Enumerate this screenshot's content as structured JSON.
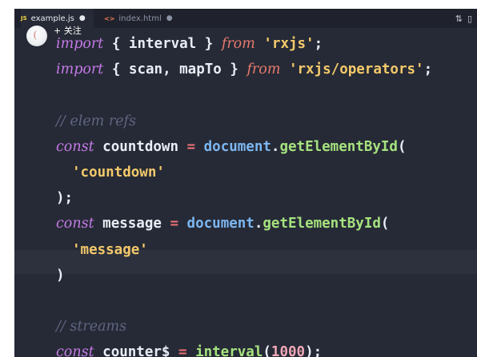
{
  "tabs": [
    {
      "icon": "JS",
      "name": "example.js",
      "modified": "●",
      "active": true
    },
    {
      "icon": "<>",
      "name": "index.html",
      "modified": "●",
      "active": false
    }
  ],
  "tab_actions": [
    "⇅",
    "▯"
  ],
  "overlay": {
    "follow_label": "+ 关注"
  },
  "code_lines": [
    {
      "tokens": [
        [
          "kw",
          "import"
        ],
        [
          "plain",
          " { interval } "
        ],
        [
          "from",
          "from"
        ],
        [
          "plain",
          " "
        ],
        [
          "str",
          "'rxjs'"
        ],
        [
          "plain",
          ";"
        ]
      ]
    },
    {
      "tokens": [
        [
          "kw",
          "import"
        ],
        [
          "plain",
          " { scan, mapTo } "
        ],
        [
          "from",
          "from"
        ],
        [
          "plain",
          " "
        ],
        [
          "str",
          "'rxjs/operators'"
        ],
        [
          "plain",
          ";"
        ]
      ]
    },
    {
      "tokens": []
    },
    {
      "tokens": [
        [
          "cmt",
          "// elem refs"
        ]
      ]
    },
    {
      "tokens": [
        [
          "kw",
          "const"
        ],
        [
          "plain",
          " countdown "
        ],
        [
          "op",
          "="
        ],
        [
          "plain",
          " "
        ],
        [
          "obj",
          "document"
        ],
        [
          "plain",
          "."
        ],
        [
          "fn",
          "getElementById"
        ],
        [
          "plain",
          "("
        ]
      ]
    },
    {
      "tokens": [
        [
          "str",
          "'countdown'"
        ]
      ],
      "indent": true
    },
    {
      "tokens": [
        [
          "plain",
          ");"
        ]
      ]
    },
    {
      "tokens": [
        [
          "kw",
          "const"
        ],
        [
          "plain",
          " message "
        ],
        [
          "op",
          "="
        ],
        [
          "plain",
          " "
        ],
        [
          "obj",
          "document"
        ],
        [
          "plain",
          "."
        ],
        [
          "fn",
          "getElementById"
        ],
        [
          "plain",
          "("
        ]
      ]
    },
    {
      "tokens": [
        [
          "str",
          "'message'"
        ]
      ],
      "indent": true
    },
    {
      "tokens": [
        [
          "plain",
          ")"
        ]
      ]
    },
    {
      "tokens": []
    },
    {
      "tokens": [
        [
          "cmt",
          "// streams"
        ]
      ]
    },
    {
      "tokens": [
        [
          "kw",
          "const"
        ],
        [
          "plain",
          " counter$ "
        ],
        [
          "op",
          "="
        ],
        [
          "plain",
          " "
        ],
        [
          "fn",
          "interval"
        ],
        [
          "plain",
          "("
        ],
        [
          "num",
          "1000"
        ],
        [
          "plain",
          ");"
        ]
      ]
    }
  ]
}
